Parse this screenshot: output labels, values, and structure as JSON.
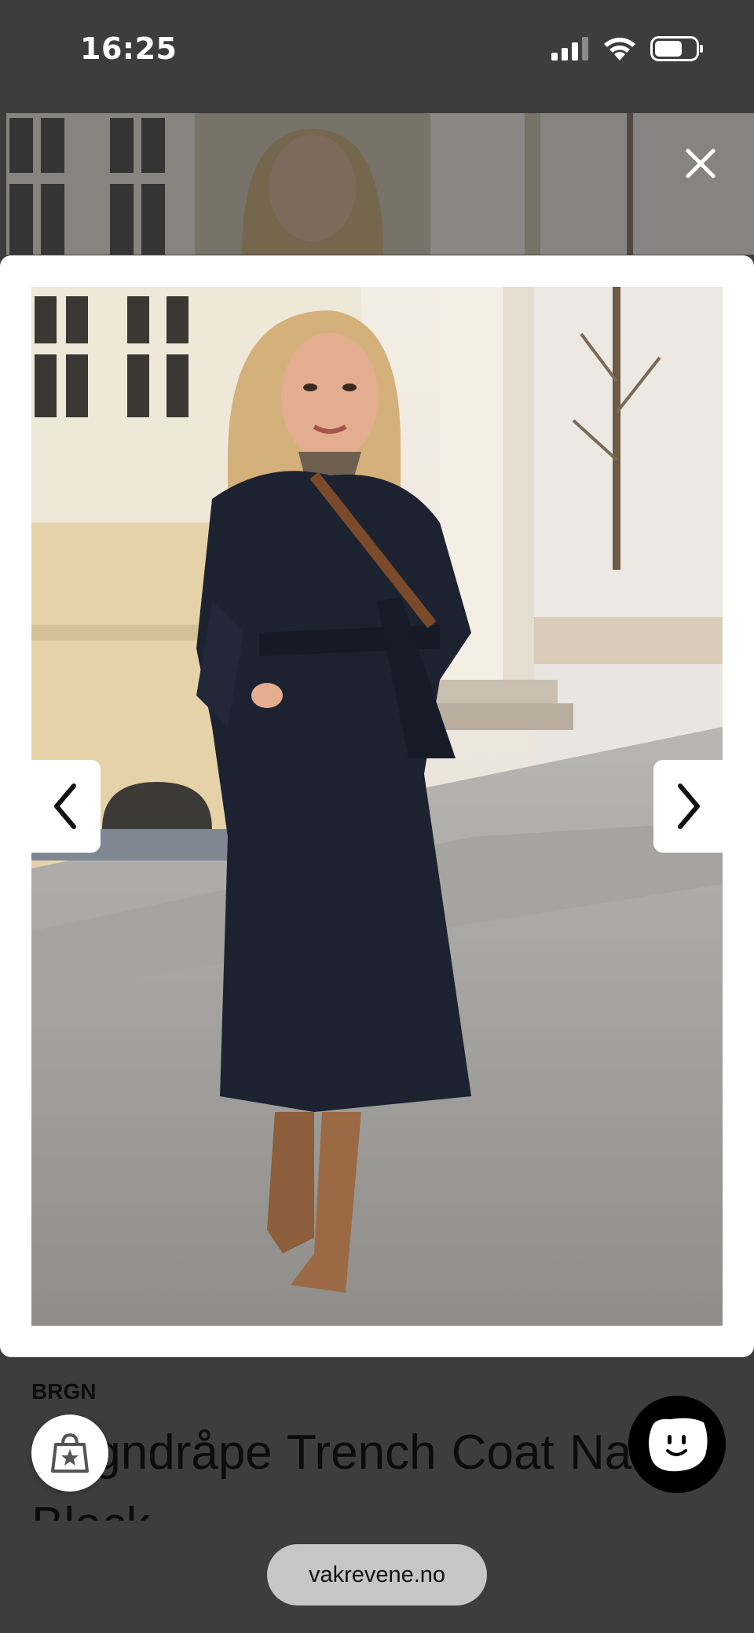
{
  "status_bar": {
    "time": "16:25",
    "icons": [
      "cellular-signal-icon",
      "wifi-icon",
      "battery-icon"
    ]
  },
  "lightbox": {
    "close_icon": "close-icon",
    "prev_icon": "chevron-left-icon",
    "next_icon": "chevron-right-icon"
  },
  "product": {
    "brand": "BRGN",
    "title": "Regndråpe Trench Coat Navy Black"
  },
  "floating": {
    "wishlist_icon": "shopping-bag-star-icon",
    "chat_icon": "smiley-chat-icon"
  },
  "browser": {
    "url": "vakrevene.no"
  },
  "colors": {
    "overlay_bg": "#3d3d3d",
    "lightbox_bg": "#ffffff",
    "url_pill": "#c6c6c6",
    "chat_button": "#000000"
  }
}
